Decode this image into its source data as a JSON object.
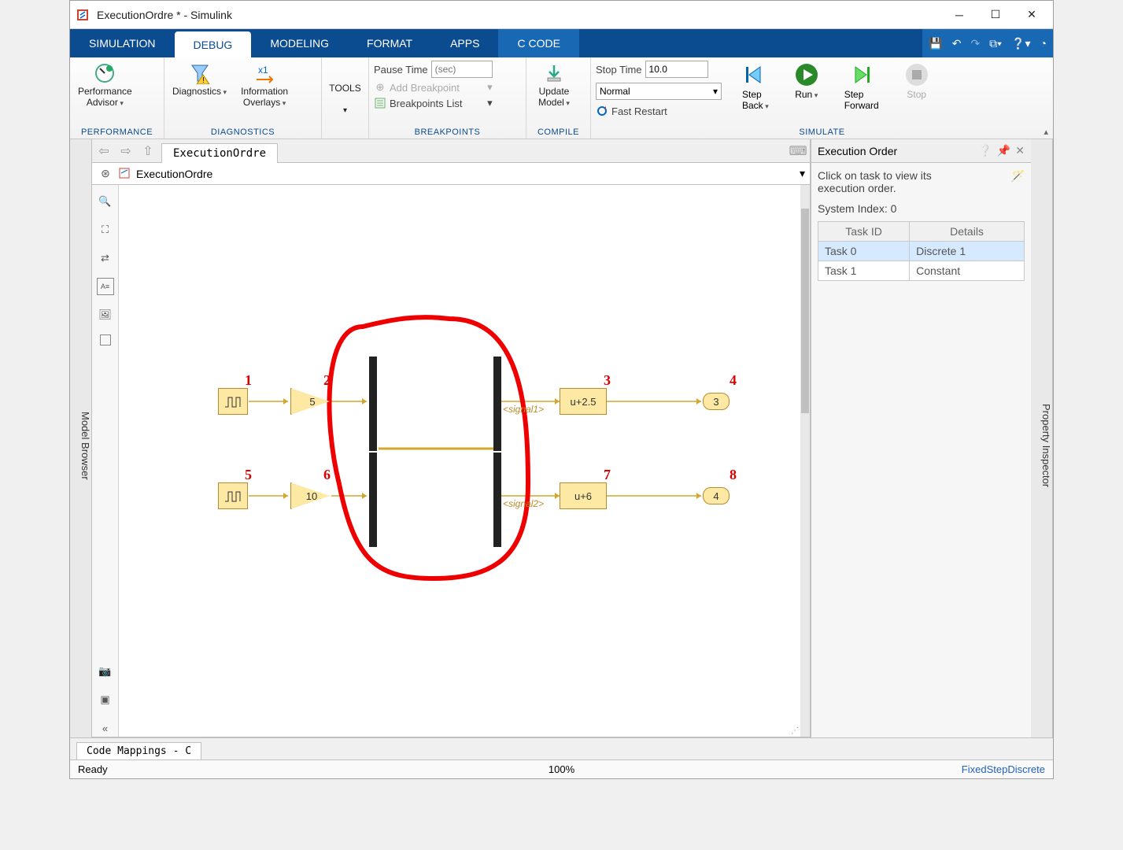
{
  "window_title": "ExecutionOrdre * - Simulink",
  "tabs": [
    "SIMULATION",
    "DEBUG",
    "MODELING",
    "FORMAT",
    "APPS",
    "C CODE"
  ],
  "active_tab": "DEBUG",
  "ribbon": {
    "perf_label": "Performance\nAdvisor",
    "performance_group": "PERFORMANCE",
    "diag_label": "Diagnostics",
    "info_label": "Information\nOverlays",
    "diagnostics_group": "DIAGNOSTICS",
    "tools_label": "TOOLS",
    "pause_time": "Pause Time",
    "pause_placeholder": "(sec)",
    "add_bp": "Add Breakpoint",
    "bp_list": "Breakpoints List",
    "breakpoints_group": "BREAKPOINTS",
    "update_model": "Update\nModel",
    "compile_group": "COMPILE",
    "stop_time": "Stop Time",
    "stop_time_val": "10.0",
    "mode": "Normal",
    "fast_restart": "Fast Restart",
    "step_back": "Step\nBack",
    "run": "Run",
    "step_fwd": "Step\nForward",
    "stop": "Stop",
    "simulate_group": "SIMULATE"
  },
  "side_left": "Model Browser",
  "side_right": "Property Inspector",
  "model_tab": "ExecutionOrdre",
  "crumb": "ExecutionOrdre",
  "exec": {
    "title": "Execution Order",
    "hint": "Click on task to view its\nexecution order.",
    "sys_index": "System Index: 0",
    "col_task": "Task ID",
    "col_details": "Details",
    "rows": [
      {
        "task": "Task 0",
        "detail": "Discrete 1",
        "sel": true
      },
      {
        "task": "Task 1",
        "detail": "Constant",
        "sel": false
      }
    ]
  },
  "bottom_tab": "Code Mappings - C",
  "status": {
    "left": "Ready",
    "mid": "100%",
    "right": "FixedStepDiscrete"
  },
  "blocks": {
    "gain1": "5",
    "gain2": "10",
    "fcn1": "u+2.5",
    "fcn2": "u+6",
    "out1": "3",
    "out2": "4",
    "sig1": "<signal1>",
    "sig2": "<signal2>"
  },
  "order": {
    "b1": "1",
    "b2": "2",
    "b3": "3",
    "b4": "4",
    "b5": "5",
    "b6": "6",
    "b7": "7",
    "b8": "8"
  }
}
